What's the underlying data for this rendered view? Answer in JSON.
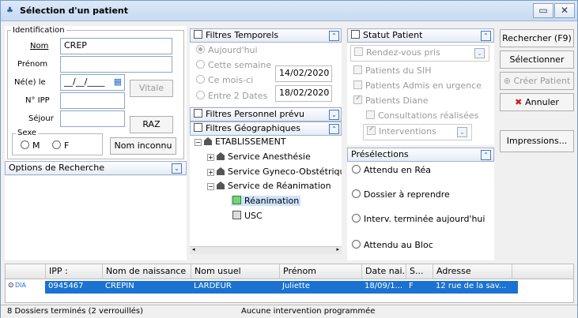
{
  "window": {
    "title": "Sélection d'un patient",
    "icons": {
      "app": "patient-app-icon",
      "restore": "restore-icon",
      "close": "close-icon"
    }
  },
  "identification": {
    "legend": "Identification",
    "nom_label": "Nom",
    "nom_value": "CREP",
    "prenom_label": "Prénom",
    "prenom_value": "",
    "nee_label": "Né(e) le",
    "date_value": "__/__/____",
    "ipp_label": "N° IPP",
    "ipp_value": "",
    "sejour_label": "Séjour",
    "sejour_value": "",
    "vitale_button": "Vitale",
    "raz_button": "RAZ",
    "sexe_legend": "Sexe",
    "sexe_m": "M",
    "sexe_f": "F",
    "nom_inconnu_button": "Nom inconnu"
  },
  "options_recherche": {
    "label": "Options de Recherche"
  },
  "filtres_temporels": {
    "label": "Filtres Temporels",
    "options": [
      "Aujourd'hui",
      "Cette semaine",
      "Ce mois-ci",
      "Entre 2 Dates"
    ],
    "date1": "14/02/2020",
    "date2": "18/02/2020"
  },
  "filtres_personnel": {
    "label": "Filtres Personnel prévu"
  },
  "filtres_geo": {
    "label": "Filtres Géographiques",
    "tree": {
      "root": "ETABLISSEMENT",
      "services": [
        "Service Anesthésie",
        "Service Gyneco-Obstétriqu",
        "Service de Réanimation"
      ],
      "units": [
        "Réanimation",
        "USC"
      ]
    }
  },
  "statut_patient": {
    "label": "Statut Patient",
    "rdv_select": "Rendez-vous pris",
    "options": [
      "Patients du SIH",
      "Patients Admis en urgence",
      "Patients Diane"
    ],
    "sub": "Consultations réalisées",
    "interventions_select": "Interventions"
  },
  "preselections": {
    "label": "Présélections",
    "items": [
      "Attendu  en Réa",
      "Dossier à reprendre",
      "Interv. terminée aujourd'hui",
      "Attendu au Bloc"
    ]
  },
  "actions": {
    "rechercher": "Rechercher (F9)",
    "selectionner": "Sélectionner",
    "creer": "Créer Patient",
    "annuler": "Annuler",
    "impressions": "Impressions..."
  },
  "grid": {
    "columns": [
      "IPP :",
      "Nom de naissance",
      "Nom usuel",
      "Prénom",
      "Date nai...",
      "S...",
      "Adresse"
    ],
    "rows": [
      {
        "marker": "DIA",
        "ipp": "0945467",
        "nom_naissance": "CREPIN",
        "nom_usuel": "LARDEUR",
        "prenom": "Juliette",
        "date": "18/09/1...",
        "sexe": "F",
        "adresse": "12 rue de la sav..."
      }
    ]
  },
  "status": {
    "left": "8 Dossiers terminés (2 verrouillés)",
    "center": "Aucune intervention programmée"
  }
}
